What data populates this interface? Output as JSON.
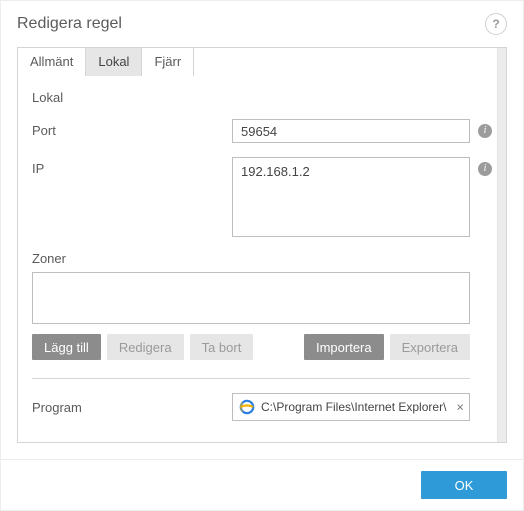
{
  "header": {
    "title": "Redigera regel"
  },
  "tabs": {
    "general": "Allmänt",
    "local": "Lokal",
    "remote": "Fjärr",
    "active": "local"
  },
  "local": {
    "section_title": "Lokal",
    "port_label": "Port",
    "port_value": "59654",
    "ip_label": "IP",
    "ip_value": "192.168.1.2",
    "zones_label": "Zoner",
    "add_btn": "Lägg till",
    "edit_btn": "Redigera",
    "remove_btn": "Ta bort",
    "import_btn": "Importera",
    "export_btn": "Exportera",
    "program_label": "Program",
    "program_value": "C:\\Program Files\\Internet Explorer\\"
  },
  "footer": {
    "ok": "OK"
  }
}
